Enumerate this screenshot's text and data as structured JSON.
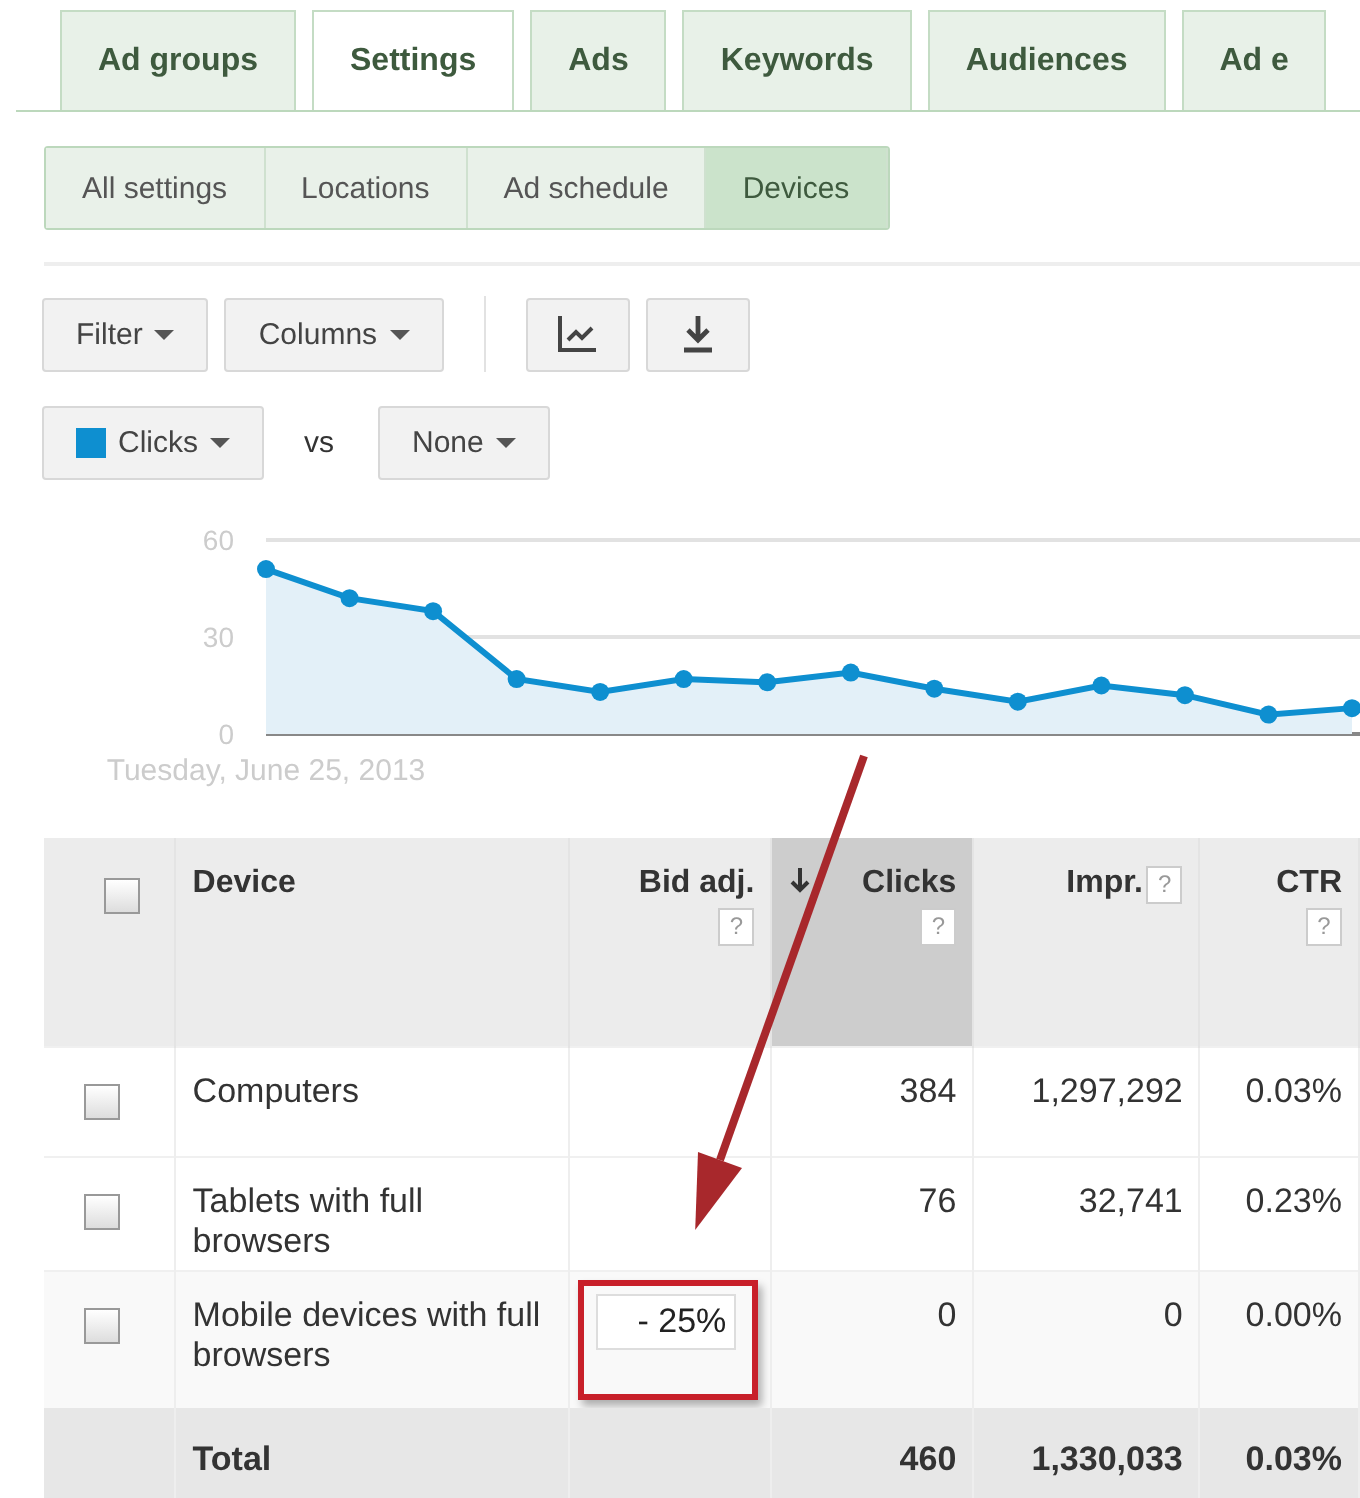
{
  "tabs": [
    {
      "label": "Ad groups",
      "selected": false
    },
    {
      "label": "Settings",
      "selected": true
    },
    {
      "label": "Ads",
      "selected": false
    },
    {
      "label": "Keywords",
      "selected": false
    },
    {
      "label": "Audiences",
      "selected": false
    },
    {
      "label": "Ad e",
      "selected": false
    }
  ],
  "subtabs": [
    {
      "label": "All settings",
      "selected": false
    },
    {
      "label": "Locations",
      "selected": false
    },
    {
      "label": "Ad schedule",
      "selected": false
    },
    {
      "label": "Devices",
      "selected": true
    }
  ],
  "toolbar": {
    "filter": "Filter",
    "columns": "Columns"
  },
  "metric_row": {
    "vs": "vs",
    "compare": "None"
  },
  "chart": {
    "chart_data": {
      "type": "area",
      "ylim": [
        0,
        60
      ],
      "yticks": [
        0,
        30,
        60
      ],
      "categories": [
        "Tuesday, June 25, 2013",
        null,
        null,
        null,
        null,
        null,
        null,
        null,
        null,
        null,
        null,
        null,
        null,
        null
      ],
      "series": [
        {
          "name": "Clicks",
          "color": "#0e8fd0",
          "values": [
            51,
            42,
            38,
            17,
            13,
            17,
            16,
            19,
            14,
            10,
            15,
            12,
            6,
            8
          ]
        }
      ]
    }
  },
  "table": {
    "select_all_checked": false,
    "columns": [
      {
        "label": "Device",
        "sorted": false
      },
      {
        "label": "Bid adj.",
        "help": "?",
        "sorted": false
      },
      {
        "label": "Clicks",
        "help": "?",
        "sorted": true
      },
      {
        "label": "Impr.",
        "help": "?",
        "sorted": false
      },
      {
        "label": "CTR",
        "help": "?",
        "sorted": false
      }
    ],
    "rows": [
      {
        "checked": false,
        "device": "Computers",
        "highlighted": false,
        "clicks": "384",
        "impr": "1,297,292",
        "ctr": "0.03%"
      },
      {
        "checked": false,
        "device": "Tablets with full browsers",
        "highlighted": false,
        "clicks": "76",
        "impr": "32,741",
        "ctr": "0.23%"
      },
      {
        "checked": false,
        "device": "Mobile devices with full browsers",
        "bid_adj": "- 25%",
        "highlighted": true,
        "clicks": "0",
        "impr": "0",
        "ctr": "0.00%"
      }
    ],
    "total": {
      "label": "Total",
      "clicks": "460",
      "impr": "1,330,033",
      "ctr": "0.03%"
    }
  }
}
